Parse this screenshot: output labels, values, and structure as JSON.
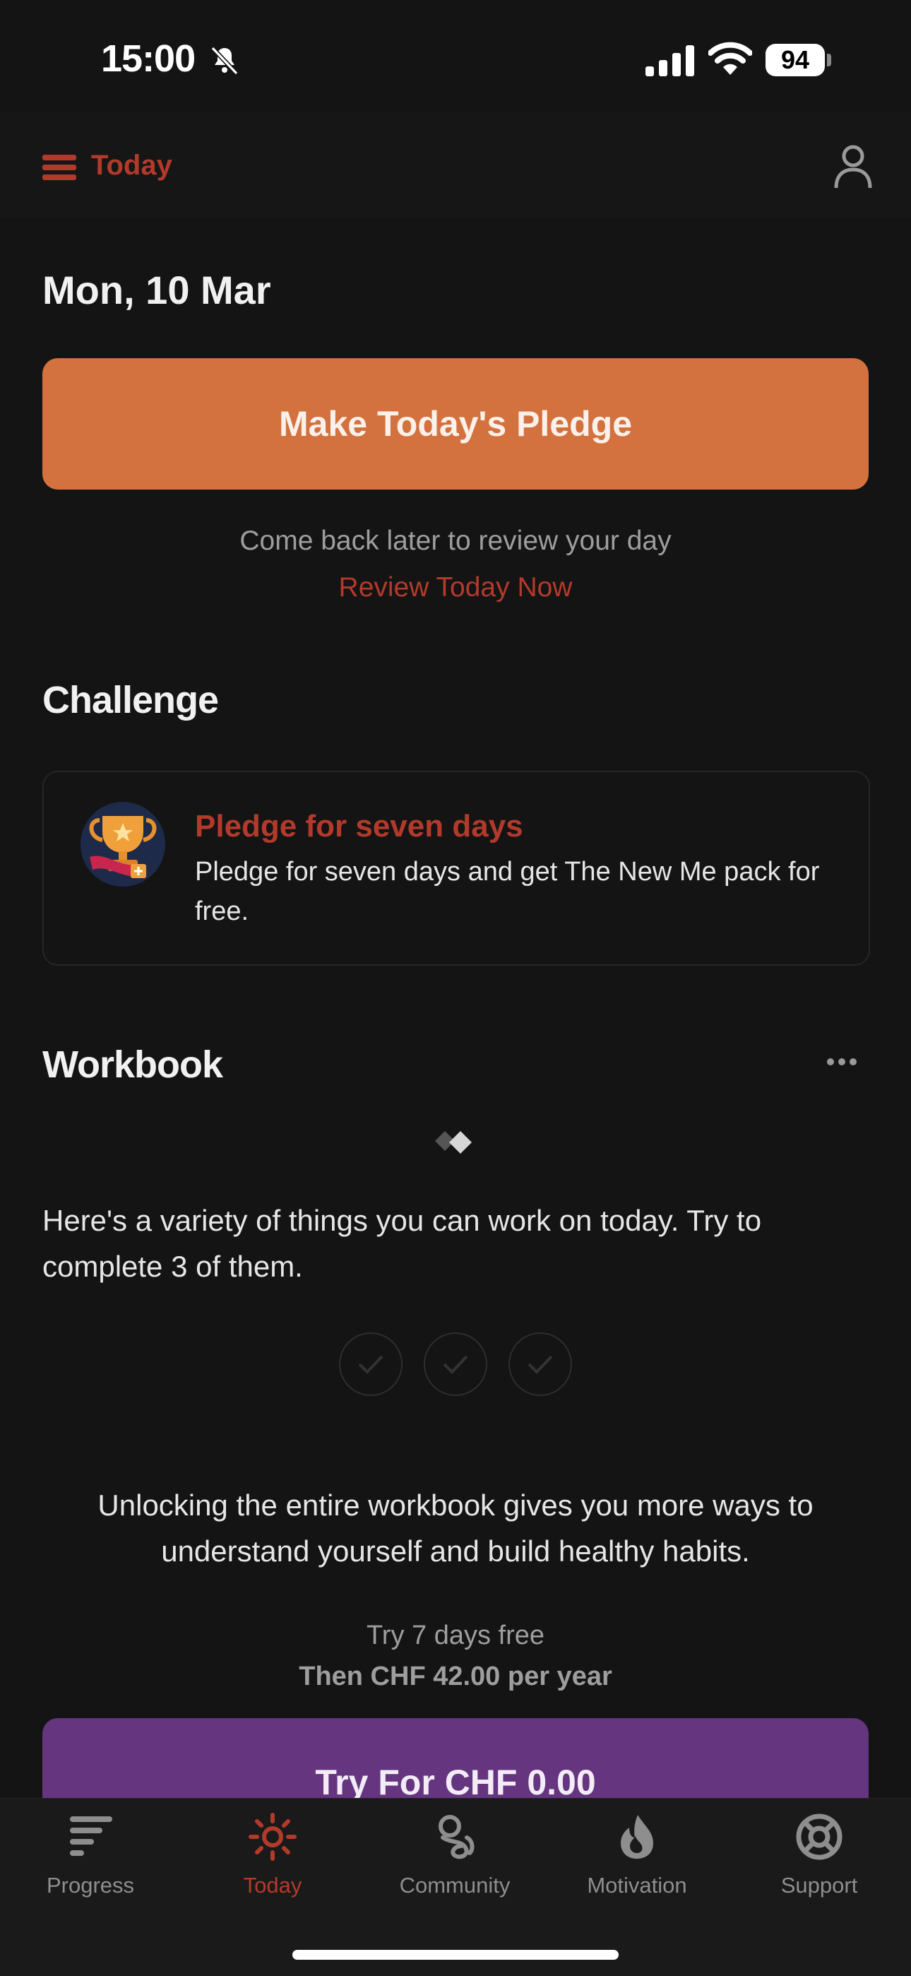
{
  "status_bar": {
    "time": "15:00",
    "battery": "94"
  },
  "header": {
    "title": "Today",
    "menu_icon": "hamburger-menu-icon",
    "profile_icon": "person-icon"
  },
  "date": "Mon, 10 Mar",
  "pledge": {
    "button_label": "Make Today's Pledge",
    "info_text": "Come back later to review your day",
    "review_link": "Review Today Now"
  },
  "challenge": {
    "section_title": "Challenge",
    "card_title": "Pledge for seven days",
    "card_description": "Pledge for seven days and get The New Me pack for free.",
    "icon": "trophy-icon"
  },
  "workbook": {
    "section_title": "Workbook",
    "intro": "Here's a variety of things you can work on today. Try to complete 3 of them.",
    "checks_total": 3,
    "checks_completed": 0,
    "unlock_text": "Unlocking the entire workbook gives you more ways to understand yourself and build healthy habits.",
    "trial_text": "Try 7 days free",
    "price_text": "Then CHF 42.00 per year",
    "cta_label": "Try For CHF 0.00"
  },
  "tabs": [
    {
      "label": "Progress",
      "icon": "progress-icon",
      "active": false
    },
    {
      "label": "Today",
      "icon": "sun-icon",
      "active": true
    },
    {
      "label": "Community",
      "icon": "community-icon",
      "active": false
    },
    {
      "label": "Motivation",
      "icon": "flame-icon",
      "active": false
    },
    {
      "label": "Support",
      "icon": "lifebuoy-icon",
      "active": false
    }
  ],
  "colors": {
    "background": "#141414",
    "accent_red": "#b33a2b",
    "pledge_orange": "#d3723f",
    "premium_purple": "#653580"
  }
}
